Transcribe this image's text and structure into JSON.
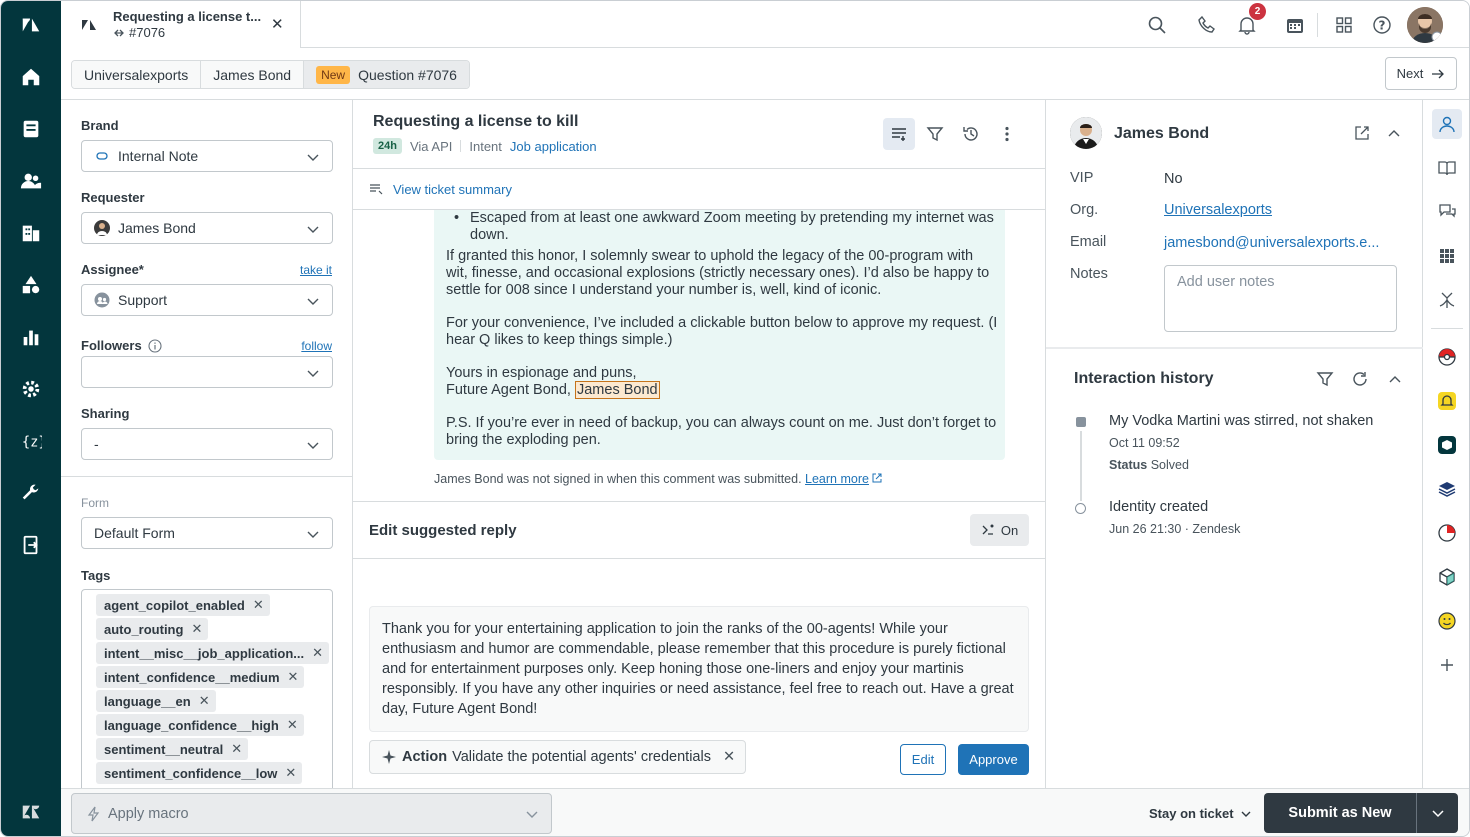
{
  "tab": {
    "title": "Requesting a license t...",
    "subtitle": "#7076"
  },
  "topbar": {
    "notification_count": "2"
  },
  "breadcrumb": {
    "org": "Universalexports",
    "requester": "James Bond",
    "status": "New",
    "ticket": "Question #7076",
    "next_label": "Next"
  },
  "props": {
    "brand_label": "Brand",
    "brand_value": "Internal Note",
    "requester_label": "Requester",
    "requester_value": "James Bond",
    "assignee_label": "Assignee*",
    "assignee_link": "take it",
    "assignee_value": "Support",
    "followers_label": "Followers",
    "followers_link": "follow",
    "followers_value": "",
    "sharing_label": "Sharing",
    "sharing_value": "-",
    "form_label": "Form",
    "form_value": "Default Form",
    "tags_label": "Tags",
    "tags": [
      "agent_copilot_enabled",
      "auto_routing",
      "intent__misc__job_application...",
      "intent_confidence__medium",
      "language__en",
      "language_confidence__high",
      "sentiment__neutral",
      "sentiment_confidence__low"
    ]
  },
  "ticket": {
    "title": "Requesting a license to kill",
    "sla": "24h",
    "via": "Via API",
    "intent_label": "Intent",
    "intent_value": "Job application",
    "summary_link": "View ticket summary",
    "message": {
      "bullet": "Escaped from at least one awkward Zoom meeting by pretending my internet was down.",
      "p1": "If granted this honor, I solemnly swear to uphold the legacy of the 00-program with wit, finesse, and occasional explosions (strictly necessary ones). I’d also be happy to settle for 008 since I understand your number is, well, kind of iconic.",
      "p2": "For your convenience, I’ve included a clickable button below to approve my request. (I hear Q likes to keep things simple.)",
      "p3a": "Yours in espionage and puns,",
      "p3b": "Future Agent Bond, ",
      "p3c": "James Bond",
      "p4": "P.S. If you’re ever in need of backup, you can always count on me. Just don’t forget to bring the exploding pen."
    },
    "not_signed": "James Bond was not signed in when this comment was submitted.",
    "learn_more": "Learn more",
    "suggest_label": "Edit suggested reply",
    "suggest_toggle": "On",
    "reply": "Thank you for your entertaining application to join the ranks of the 00-agents! While your enthusiasm and humor are commendable, please remember that this procedure is purely fictional and for entertainment purposes only. Keep honing those one-liners and enjoy your martinis responsibly. If you have any other inquiries or need assistance, feel free to reach out. Have a great day, Future Agent Bond!",
    "action_label": "Action",
    "action_text": "Validate the potential agents' credentials",
    "edit_label": "Edit",
    "approve_label": "Approve"
  },
  "user": {
    "name": "James Bond",
    "vip_label": "VIP",
    "vip_value": "No",
    "org_label": "Org.",
    "org_value": "Universalexports",
    "email_label": "Email",
    "email_value": "jamesbond@universalexports.e...",
    "notes_label": "Notes",
    "notes_placeholder": "Add user notes",
    "history_title": "Interaction history",
    "events": [
      {
        "title": "My Vodka Martini was stirred, not shaken",
        "time": "Oct 11 09:52",
        "status_label": "Status",
        "status_value": "Solved"
      },
      {
        "title": "Identity created",
        "time": "Jun 26 21:30 · Zendesk"
      }
    ]
  },
  "bottom": {
    "macro_placeholder": "Apply macro",
    "stay_label": "Stay on ticket",
    "submit_label": "Submit as New"
  }
}
